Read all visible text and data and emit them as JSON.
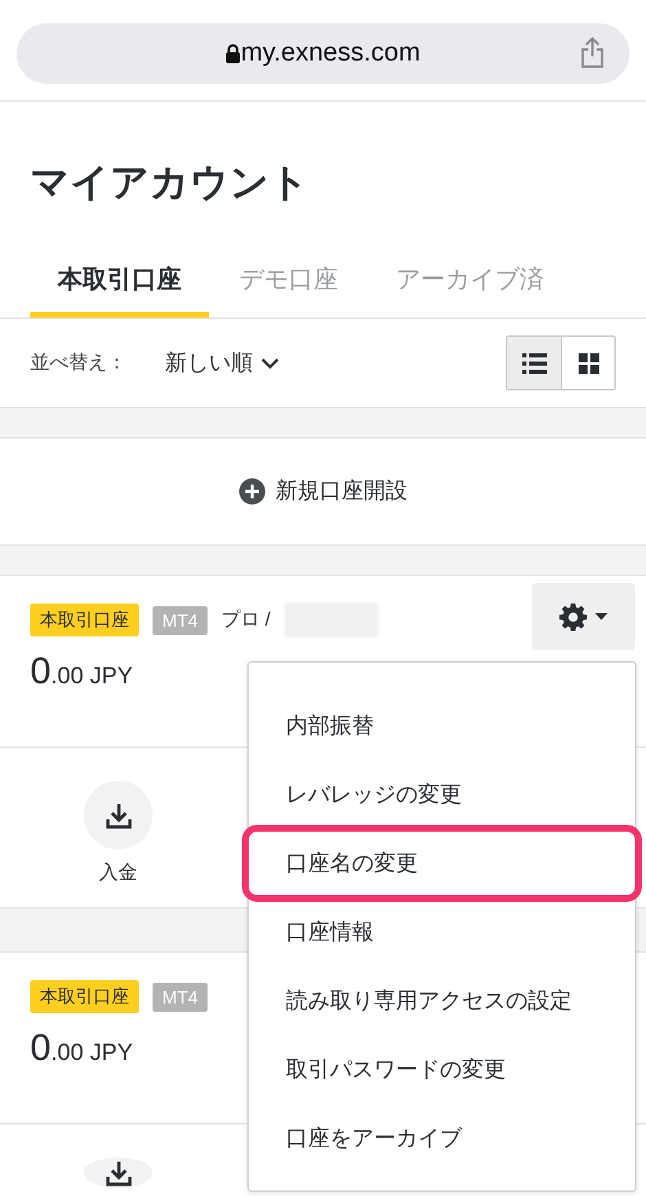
{
  "address_bar": {
    "url": "my.exness.com"
  },
  "page_title": "マイアカウント",
  "tabs": [
    {
      "label": "本取引口座",
      "selected": true
    },
    {
      "label": "デモ口座",
      "selected": false
    },
    {
      "label": "アーカイブ済",
      "selected": false
    }
  ],
  "sort": {
    "label": "並べ替え：",
    "value": "新しい順"
  },
  "view_toggle": [
    {
      "kind": "list",
      "selected": true
    },
    {
      "kind": "grid",
      "selected": false
    }
  ],
  "new_account_button": "新規口座開設",
  "accounts": [
    {
      "type_badge": "本取引口座",
      "platform_badge": "MT4",
      "name": "プロ /",
      "balance_integer": "0",
      "balance_fraction": ".00 JPY",
      "actions": [
        {
          "kind": "deposit",
          "label": "入金"
        }
      ]
    },
    {
      "type_badge": "本取引口座",
      "platform_badge": "MT4",
      "balance_integer": "0",
      "balance_fraction": ".00 JPY",
      "actions": [
        {
          "kind": "deposit"
        }
      ]
    }
  ],
  "account_menu": {
    "items": [
      {
        "label": "内部振替",
        "highlighted": false
      },
      {
        "label": "レバレッジの変更",
        "highlighted": false
      },
      {
        "label": "口座名の変更",
        "highlighted": true
      },
      {
        "label": "口座情報",
        "highlighted": false
      },
      {
        "label": "読み取り専用アクセスの設定",
        "highlighted": false
      },
      {
        "label": "取引パスワードの変更",
        "highlighted": false
      },
      {
        "label": "口座をアーカイブ",
        "highlighted": false
      }
    ]
  }
}
